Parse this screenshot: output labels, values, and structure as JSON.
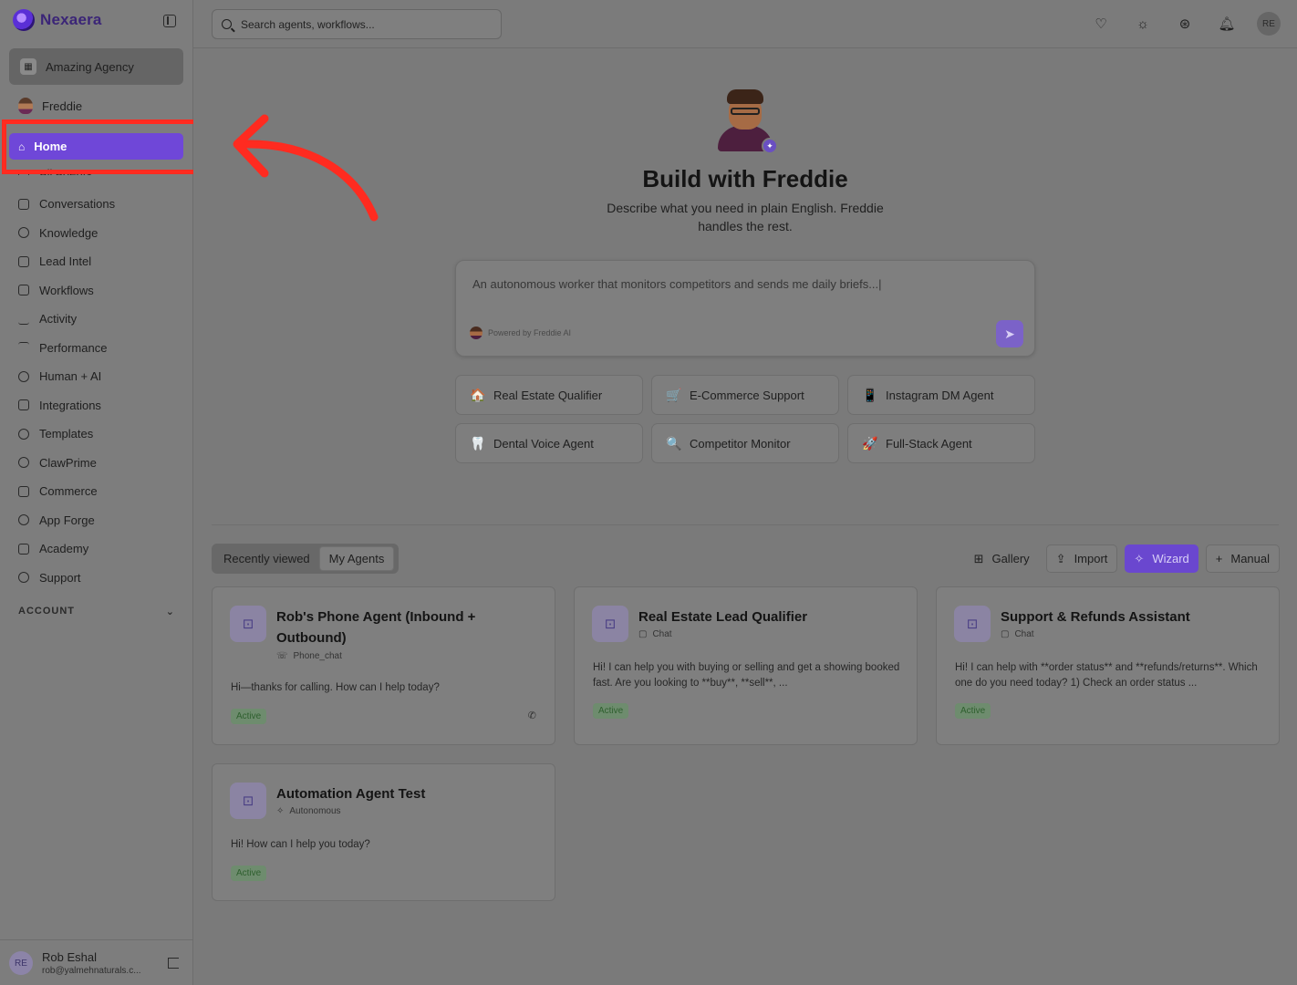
{
  "brand": {
    "name": "Nexaera"
  },
  "workspace": {
    "label": "Amazing Agency"
  },
  "sidebar_user": {
    "name": "Freddie"
  },
  "nav": {
    "home": "Home",
    "partial": "All Agents",
    "items": [
      {
        "label": "Conversations",
        "icon": "chat-icon"
      },
      {
        "label": "Knowledge",
        "icon": "brain-icon"
      },
      {
        "label": "Lead Intel",
        "icon": "contact-icon"
      },
      {
        "label": "Workflows",
        "icon": "workflow-icon"
      },
      {
        "label": "Activity",
        "icon": "activity-icon"
      },
      {
        "label": "Performance",
        "icon": "trend-icon"
      },
      {
        "label": "Human + AI",
        "icon": "network-icon"
      },
      {
        "label": "Integrations",
        "icon": "plug-icon"
      },
      {
        "label": "Templates",
        "icon": "share-icon"
      },
      {
        "label": "ClawPrime",
        "icon": "paw-icon"
      },
      {
        "label": "Commerce",
        "icon": "cart-icon"
      },
      {
        "label": "App Forge",
        "icon": "sparkles-icon"
      },
      {
        "label": "Academy",
        "icon": "graduation-cap-icon"
      },
      {
        "label": "Support",
        "icon": "lifebuoy-icon"
      }
    ],
    "account_label": "ACCOUNT"
  },
  "profile": {
    "initials": "RE",
    "name": "Rob Eshal",
    "email": "rob@yalmehnaturals.c..."
  },
  "search": {
    "placeholder": "Search agents, workflows..."
  },
  "topbar": {
    "avatar_initials": "RE"
  },
  "hero": {
    "title": "Build with Freddie",
    "subtitle": "Describe what you need in plain English. Freddie handles the rest.",
    "prompt_placeholder": "An autonomous worker that monitors competitors and sends me daily briefs...|",
    "powered_by": "Powered by Freddie AI"
  },
  "quick_starts": [
    {
      "label": "Real Estate Qualifier",
      "emoji": "🏠"
    },
    {
      "label": "E-Commerce Support",
      "emoji": "🛒"
    },
    {
      "label": "Instagram DM Agent",
      "emoji": "📱"
    },
    {
      "label": "Dental Voice Agent",
      "emoji": "🦷"
    },
    {
      "label": "Competitor Monitor",
      "emoji": "🔍"
    },
    {
      "label": "Full-Stack Agent",
      "emoji": "🚀"
    }
  ],
  "tabs": {
    "recent": "Recently viewed",
    "mine": "My Agents"
  },
  "actions": {
    "gallery": "Gallery",
    "import": "Import",
    "wizard": "Wizard",
    "manual": "Manual"
  },
  "agents": [
    {
      "title": "Rob's Phone Agent (Inbound + Outbound)",
      "type": "Phone_chat",
      "desc": "Hi—thanks for calling. How can I help today?",
      "status": "Active"
    },
    {
      "title": "Real Estate Lead Qualifier",
      "type": "Chat",
      "desc": "Hi! I can help you with buying or selling and get a showing booked fast. Are you looking to **buy**, **sell**, ...",
      "status": "Active"
    },
    {
      "title": "Support & Refunds Assistant",
      "type": "Chat",
      "desc": "Hi! I can help with **order status** and **refunds/returns**. Which one do you need today? 1) Check an order status ...",
      "status": "Active"
    },
    {
      "title": "Automation Agent Test",
      "type": "Autonomous",
      "desc": "Hi! How can I help you today?",
      "status": "Active"
    }
  ]
}
